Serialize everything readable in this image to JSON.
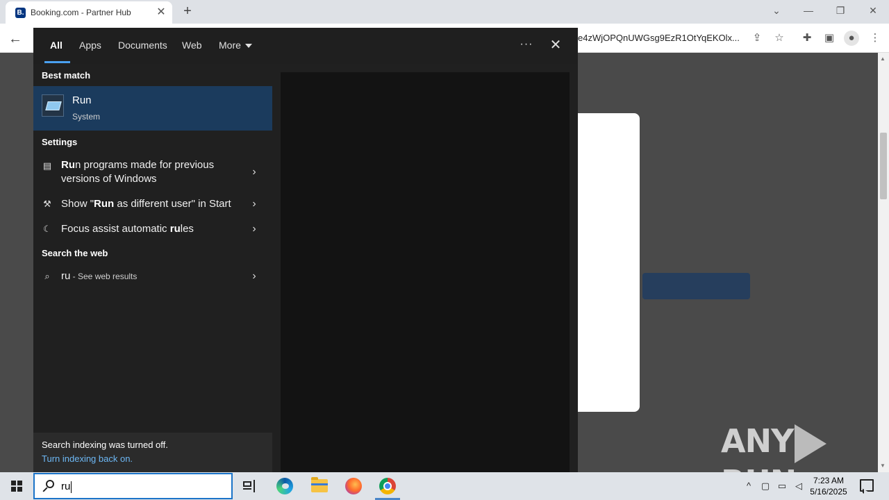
{
  "browser": {
    "tab_title": "Booking.com - Partner Hub",
    "tab_favicon_letter": "B.",
    "new_tab_label": "+",
    "url": "e4zWjOPQnUWGsg9EzR1OtYqEKOlx..."
  },
  "search_panel": {
    "filter_tabs": [
      "All",
      "Apps",
      "Documents",
      "Web",
      "More"
    ],
    "active_tab": "All",
    "best_match_header": "Best match",
    "best_match": {
      "title": "Run",
      "subtitle": "System"
    },
    "settings_header": "Settings",
    "settings": [
      {
        "bold": "Ru",
        "rest": "n programs made for previous versions of Windows"
      },
      {
        "pre": "Show \"",
        "bold": "Run",
        "rest": " as different user\" in Start"
      },
      {
        "pre": "Focus assist automatic ",
        "bold": "ru",
        "rest": "les"
      }
    ],
    "web_header": "Search the web",
    "web_result": {
      "query": "ru",
      "suffix": " - See web results"
    },
    "indexing_note": "Search indexing was turned off.",
    "indexing_link": "Turn indexing back on."
  },
  "taskbar": {
    "search_value": "ru",
    "time": "7:23 AM",
    "date": "5/16/2025"
  },
  "watermark": {
    "left": "ANY",
    "right": "RUN"
  },
  "colors": {
    "accent": "#4aa0f0",
    "best_match_bg": "#1b3b5d",
    "panel_bg": "#202020",
    "search_border": "#1a73c8"
  },
  "icons": {
    "tab_close": "close-icon",
    "back": "back-arrow-icon",
    "share": "share-icon",
    "bookmark": "star-icon",
    "extensions": "puzzle-icon",
    "sidebar": "side-panel-icon",
    "profile": "avatar-icon",
    "menu": "kebab-menu-icon"
  }
}
